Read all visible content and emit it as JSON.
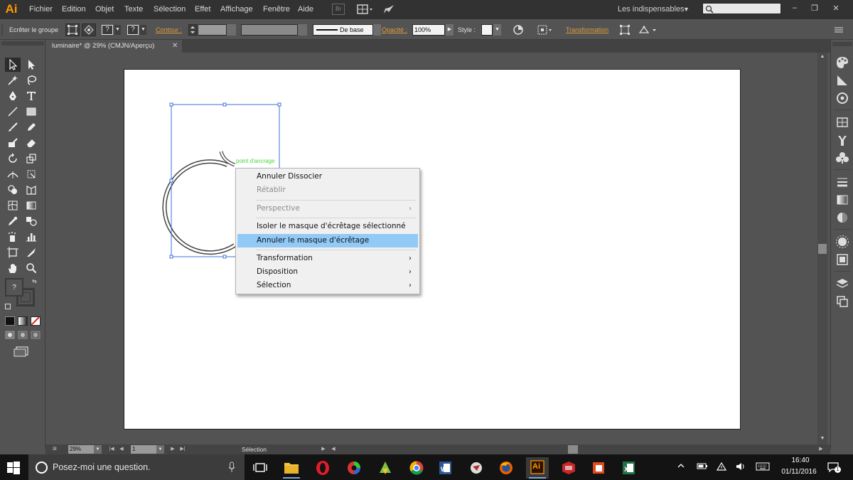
{
  "app": {
    "logo": "Ai",
    "menus": [
      "Fichier",
      "Edition",
      "Objet",
      "Texte",
      "Sélection",
      "Effet",
      "Affichage",
      "Fenêtre",
      "Aide"
    ],
    "bridge_label": "Br",
    "workspace": "Les indispensables",
    "window_buttons": {
      "minimize": "–",
      "maximize": "❐",
      "close": "✕"
    }
  },
  "control_bar": {
    "isolate_group": "Ecrêter le groupe",
    "stroke_label": "Contour :",
    "brush_label": "De base",
    "opacity_label": "Opacité :",
    "opacity_value": "100%",
    "style_label": "Style :",
    "transform_label": "Transformation"
  },
  "document": {
    "tab_title": "luminaire* @ 29% (CMJN/Aperçu)",
    "tab_close": "✕",
    "anchor_hint": "point d'ancrage"
  },
  "context_menu": {
    "items": [
      {
        "label": "Annuler Dissocier",
        "enabled": true,
        "submenu": false,
        "highlighted": false
      },
      {
        "label": "Rétablir",
        "enabled": false,
        "submenu": false,
        "highlighted": false
      },
      {
        "label": "Perspective",
        "enabled": false,
        "submenu": true,
        "highlighted": false
      },
      {
        "label": "Isoler le masque d'écrêtage sélectionné",
        "enabled": true,
        "submenu": false,
        "highlighted": false
      },
      {
        "label": "Annuler le masque d'écrêtage",
        "enabled": true,
        "submenu": false,
        "highlighted": true
      },
      {
        "label": "Transformation",
        "enabled": true,
        "submenu": true,
        "highlighted": false
      },
      {
        "label": "Disposition",
        "enabled": true,
        "submenu": true,
        "highlighted": false
      },
      {
        "label": "Sélection",
        "enabled": true,
        "submenu": true,
        "highlighted": false
      }
    ],
    "arrow": "›"
  },
  "toolbar": {
    "fill_label": "?"
  },
  "status_bar": {
    "zoom": "29%",
    "page": "1",
    "status": "Sélection"
  },
  "taskbar": {
    "search_placeholder": "Posez-moi une question.",
    "apps": [
      "task-view",
      "file-explorer",
      "opera",
      "app-colorful",
      "app-green",
      "chrome",
      "word",
      "app-bird",
      "firefox",
      "illustrator",
      "app-red",
      "app-orange",
      "excel"
    ],
    "illustrator_label": "Ai",
    "time": "16:40",
    "date": "01/11/2016",
    "notification_count": "1"
  },
  "colors": {
    "accent_orange": "#ff9a00",
    "menu_highlight": "#91c9f7",
    "selection_blue": "#3b6fd8",
    "anchor_green": "#4cd33b",
    "link_orange": "#e09b3d"
  }
}
